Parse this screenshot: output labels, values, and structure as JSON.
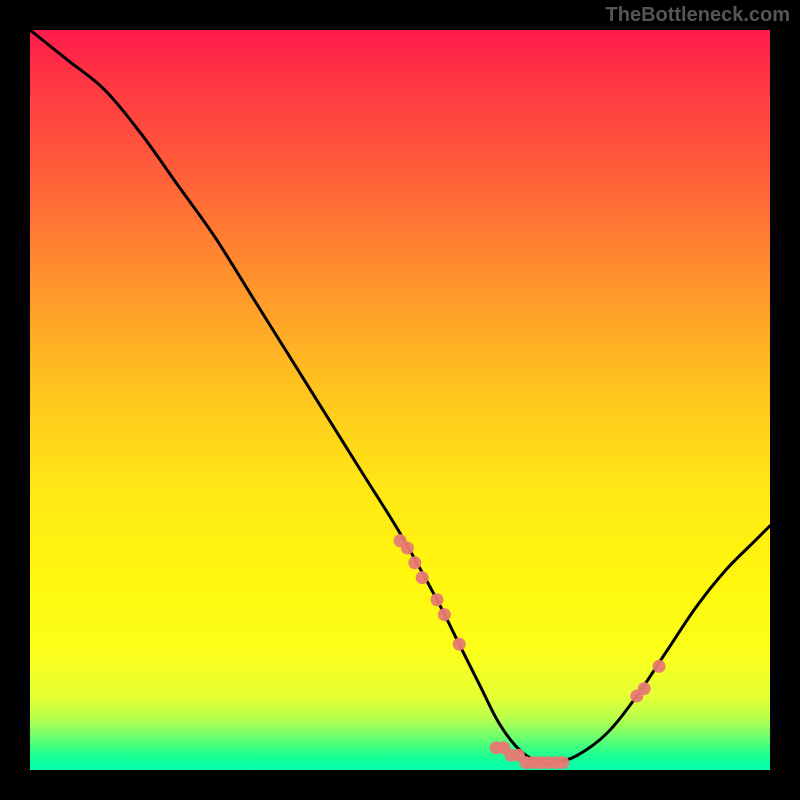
{
  "watermark": "TheBottleneck.com",
  "chart_data": {
    "type": "line",
    "title": "",
    "xlabel": "",
    "ylabel": "",
    "xlim": [
      0,
      100
    ],
    "ylim": [
      0,
      100
    ],
    "gradient_colors": {
      "top": "#ff1a4d",
      "upper_mid": "#ffc21f",
      "lower_mid": "#fff80f",
      "bottom": "#08ffad"
    },
    "series": [
      {
        "name": "bottleneck-curve",
        "x": [
          0,
          5,
          10,
          15,
          20,
          25,
          30,
          35,
          40,
          45,
          50,
          55,
          58,
          61,
          63,
          65,
          67,
          69,
          71,
          74,
          78,
          82,
          86,
          90,
          94,
          98,
          100
        ],
        "y": [
          100,
          96,
          92,
          86,
          79,
          72,
          64,
          56,
          48,
          40,
          32,
          23,
          17,
          11,
          7,
          4,
          2,
          1,
          1,
          2,
          5,
          10,
          16,
          22,
          27,
          31,
          33
        ]
      }
    ],
    "highlight_points": {
      "name": "data-markers",
      "color": "#e77a73",
      "x": [
        50,
        51,
        52,
        53,
        55,
        56,
        58,
        63,
        64,
        65,
        66,
        67,
        68,
        69,
        70,
        71,
        72,
        82,
        83,
        85
      ],
      "y": [
        31,
        30,
        28,
        26,
        23,
        21,
        17,
        3,
        3,
        2,
        2,
        1,
        1,
        1,
        1,
        1,
        1,
        10,
        11,
        14
      ]
    }
  }
}
